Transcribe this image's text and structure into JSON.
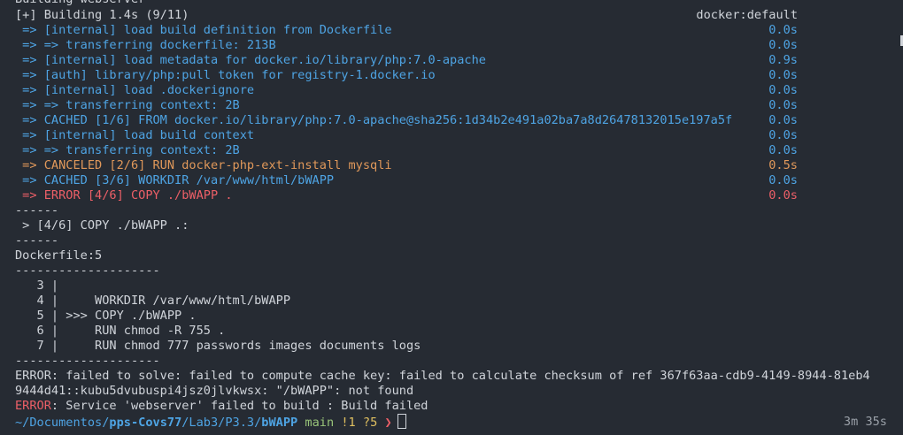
{
  "terminal": {
    "top_partial": "Building webserver",
    "build_status": "[+] Building 1.4s (9/11)",
    "builder": "docker:default",
    "steps": [
      {
        "text": " => [internal] load build definition from Dockerfile",
        "time": "0.0s"
      },
      {
        "text": " => => transferring dockerfile: 213B",
        "time": "0.0s"
      },
      {
        "text": " => [internal] load metadata for docker.io/library/php:7.0-apache",
        "time": "0.9s"
      },
      {
        "text": " => [auth] library/php:pull token for registry-1.docker.io",
        "time": "0.0s"
      },
      {
        "text": " => [internal] load .dockerignore",
        "time": "0.0s"
      },
      {
        "text": " => => transferring context: 2B",
        "time": "0.0s"
      },
      {
        "text": " => CACHED [1/6] FROM docker.io/library/php:7.0-apache@sha256:1d34b2e491a02ba7a8d26478132015e197a5f",
        "time": "0.0s"
      },
      {
        "text": " => [internal] load build context",
        "time": "0.0s"
      },
      {
        "text": " => => transferring context: 2B",
        "time": "0.0s"
      },
      {
        "text": " => CANCELED [2/6] RUN docker-php-ext-install mysqli",
        "time": "0.5s"
      },
      {
        "text": " => CACHED [3/6] WORKDIR /var/www/html/bWAPP",
        "time": "0.0s"
      },
      {
        "text": " => ERROR [4/6] COPY ./bWAPP .",
        "time": "0.0s"
      }
    ],
    "sep_short_1": "------",
    "copy_line": " > [4/6] COPY ./bWAPP .:",
    "sep_short_2": "------",
    "dockerfile_ref": "Dockerfile:5",
    "sep_long_1": "--------------------",
    "source_lines": [
      "   3 |",
      "   4 |     WORKDIR /var/www/html/bWAPP",
      "   5 | >>> COPY ./bWAPP .",
      "   6 |     RUN chmod -R 755 .",
      "   7 |     RUN chmod 777 passwords images documents logs"
    ],
    "sep_long_2": "--------------------",
    "error_line_1": "ERROR: failed to solve: failed to compute cache key: failed to calculate checksum of ref 367f63aa-cdb9-4149-8944-81eb4",
    "error_line_2": "9444d41::kubu5dvubuspi4jsz0jlvkwsx: \"/bWAPP\": not found",
    "error_label": "ERROR",
    "error_line_3_rest": ": Service 'webserver' failed to build : Build failed",
    "prompt": {
      "cwd_prefix": "~/Documentos/",
      "cwd_bold_1": "pps-Covs77",
      "cwd_mid": "/Lab3/P3.3/",
      "cwd_bold_2": "bWAPP",
      "branch": "main",
      "git_status": "!1 ?5",
      "arrow": "❯",
      "duration": "3m 35s"
    }
  },
  "colors": {
    "background": "#262b33",
    "foreground": "#d0d4da",
    "info": "#4ea4e4",
    "canceled": "#e0985a",
    "error": "#ec5f67",
    "branch": "#98c379",
    "git_status": "#e0c060"
  }
}
